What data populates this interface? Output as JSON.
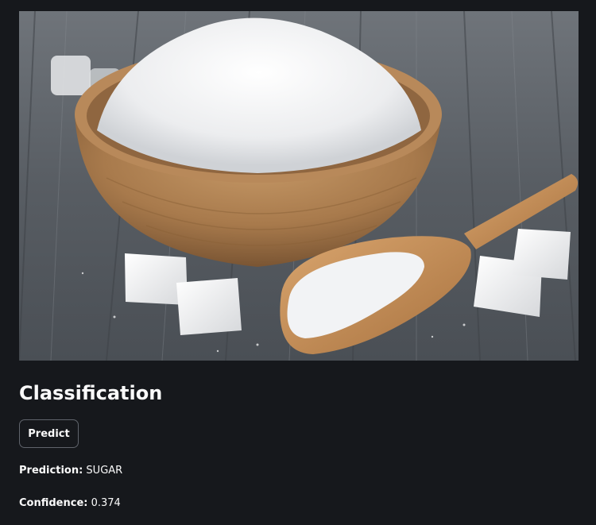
{
  "image": {
    "subject": "wooden bowl of granulated sugar with wooden scoop and sugar cubes on grey wooden table"
  },
  "classification": {
    "title": "Classification",
    "predict_label": "Predict",
    "prediction_key": "Prediction:",
    "prediction_value": "SUGAR",
    "confidence_key": "Confidence:",
    "confidence_value": "0.374"
  },
  "colors": {
    "background": "#16181c",
    "text": "#fafafa",
    "button_border": "#60646c"
  }
}
